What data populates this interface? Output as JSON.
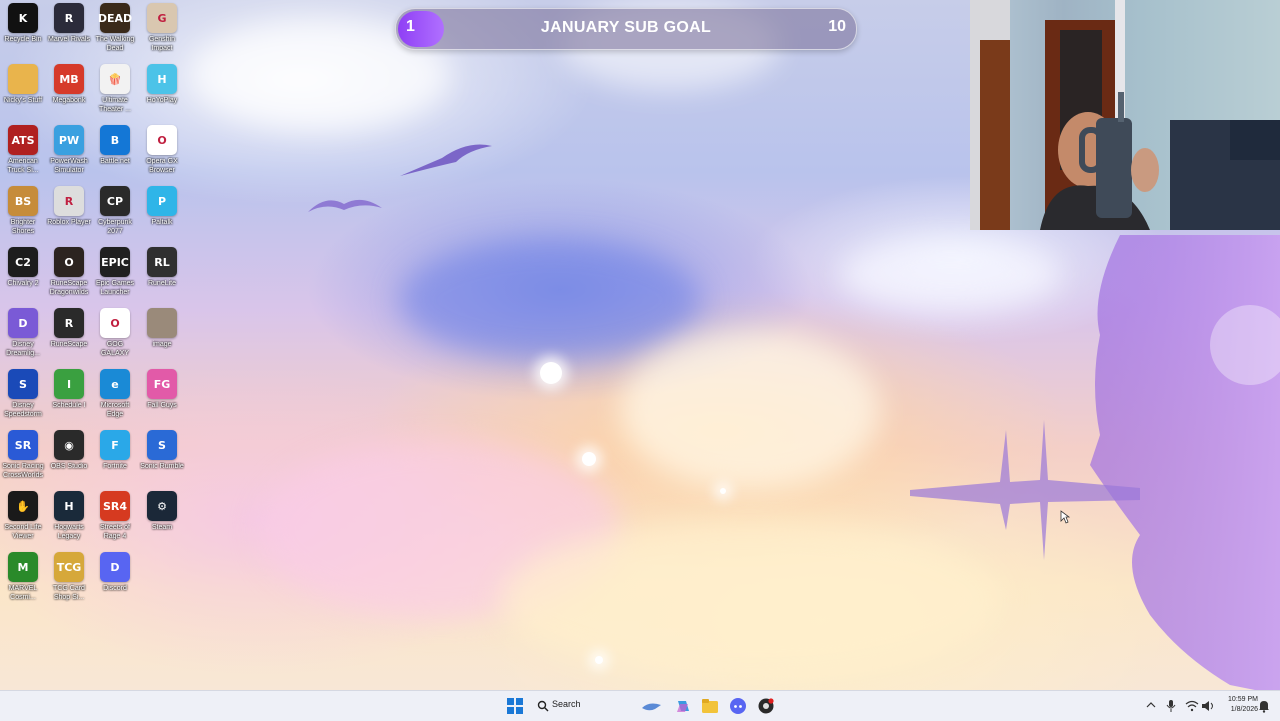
{
  "sub_goal": {
    "title": "JANUARY SUB GOAL",
    "current": "1",
    "target": "10",
    "progress": 0.1,
    "accent": "#8f3ff5"
  },
  "desktop_icons": [
    {
      "label": "Recycle Bin",
      "icon": "recycle-bin-icon",
      "color": "#111111",
      "glyph": "K"
    },
    {
      "label": "Marvel Rivals",
      "icon": "marvel-rivals-icon",
      "color": "#2b2b3a",
      "glyph": "R"
    },
    {
      "label": "The Walking Dead",
      "icon": "walking-dead-icon",
      "color": "#3a2a1a",
      "glyph": "DEAD"
    },
    {
      "label": "Genshin Impact",
      "icon": "genshin-impact-icon",
      "color": "#d9c7b0",
      "glyph": "G"
    },
    {
      "label": "Nicky's Stuff",
      "icon": "folder-icon",
      "color": "#e9b44c",
      "glyph": ""
    },
    {
      "label": "Megabonk",
      "icon": "megabonk-icon",
      "color": "#d63a2a",
      "glyph": "MB"
    },
    {
      "label": "Ultimate Theater ...",
      "icon": "theater-icon",
      "color": "#f2f2f2",
      "glyph": "🍿"
    },
    {
      "label": "HoYoPlay",
      "icon": "hoyoplay-icon",
      "color": "#4cc3e8",
      "glyph": "H"
    },
    {
      "label": "American Truck Si...",
      "icon": "american-truck-icon",
      "color": "#b02020",
      "glyph": "ATS"
    },
    {
      "label": "PowerWash Simulator",
      "icon": "powerwash-icon",
      "color": "#3aa0e0",
      "glyph": "PW"
    },
    {
      "label": "Battle.net",
      "icon": "battlenet-icon",
      "color": "#1477d6",
      "glyph": "B"
    },
    {
      "label": "Opera GX Browser",
      "icon": "opera-gx-icon",
      "color": "#ffffff",
      "glyph": "O"
    },
    {
      "label": "Brighter Shores",
      "icon": "brighter-shores-icon",
      "color": "#c68c3a",
      "glyph": "BS"
    },
    {
      "label": "Roblox Player",
      "icon": "roblox-icon",
      "color": "#dddddd",
      "glyph": "R"
    },
    {
      "label": "Cyberpunk 2077",
      "icon": "cyberpunk-icon",
      "color": "#2a2a2a",
      "glyph": "CP"
    },
    {
      "label": "Paltalk",
      "icon": "paltalk-icon",
      "color": "#2fb5e8",
      "glyph": "P"
    },
    {
      "label": "Chivalry 2",
      "icon": "chivalry-icon",
      "color": "#1d1d1d",
      "glyph": "C2"
    },
    {
      "label": "RuneScape Dragonwilds",
      "icon": "dragonwilds-icon",
      "color": "#2c2420",
      "glyph": "O"
    },
    {
      "label": "Epic Games Launcher",
      "icon": "epic-games-icon",
      "color": "#202020",
      "glyph": "EPIC"
    },
    {
      "label": "RuneLite",
      "icon": "runelite-icon",
      "color": "#303030",
      "glyph": "RL"
    },
    {
      "label": "Disney Dreamlig...",
      "icon": "disney-dreamlight-icon",
      "color": "#7a5ad6",
      "glyph": "D"
    },
    {
      "label": "RuneScape",
      "icon": "runescape-icon",
      "color": "#2a2a2a",
      "glyph": "R"
    },
    {
      "label": "GOG GALAXY",
      "icon": "gog-galaxy-icon",
      "color": "#ffffff",
      "glyph": "O"
    },
    {
      "label": "image",
      "icon": "image-icon",
      "color": "#9a8a7a",
      "glyph": ""
    },
    {
      "label": "Disney Speedstorm",
      "icon": "speedstorm-icon",
      "color": "#1a4ab8",
      "glyph": "S"
    },
    {
      "label": "Schedule I",
      "icon": "schedule-one-icon",
      "color": "#3aa040",
      "glyph": "I"
    },
    {
      "label": "Microsoft Edge",
      "icon": "edge-icon",
      "color": "#1a8ad6",
      "glyph": "e"
    },
    {
      "label": "Fall Guys",
      "icon": "fall-guys-icon",
      "color": "#e25aa8",
      "glyph": "FG"
    },
    {
      "label": "Sonic Racing CrossWorlds",
      "icon": "sonic-racing-icon",
      "color": "#2a5ad6",
      "glyph": "SR"
    },
    {
      "label": "OBS Studio",
      "icon": "obs-studio-icon",
      "color": "#2a2a2a",
      "glyph": "◉"
    },
    {
      "label": "Fortnite",
      "icon": "fortnite-icon",
      "color": "#2aa8e8",
      "glyph": "F"
    },
    {
      "label": "Sonic Rumble",
      "icon": "sonic-rumble-icon",
      "color": "#2a6ad6",
      "glyph": "S"
    },
    {
      "label": "Second Life Viewer",
      "icon": "second-life-icon",
      "color": "#1a1a1a",
      "glyph": "✋"
    },
    {
      "label": "Hogwarts Legacy",
      "icon": "hogwarts-icon",
      "color": "#1a2a3a",
      "glyph": "H"
    },
    {
      "label": "Streets of Rage 4",
      "icon": "streets-of-rage-icon",
      "color": "#d63a20",
      "glyph": "SR4"
    },
    {
      "label": "Steam",
      "icon": "steam-icon",
      "color": "#1b2838",
      "glyph": "⚙"
    },
    {
      "label": "MARVEL Cosmi...",
      "icon": "marvel-cosmic-icon",
      "color": "#2a8a2a",
      "glyph": "M"
    },
    {
      "label": "TCG Card Shop Si...",
      "icon": "tcg-card-shop-icon",
      "color": "#d6a83a",
      "glyph": "TCG"
    },
    {
      "label": "Discord",
      "icon": "discord-icon",
      "color": "#5865f2",
      "glyph": "D"
    }
  ],
  "taskbar": {
    "search_label": "Search",
    "apps": [
      {
        "icon": "windows-start-icon"
      },
      {
        "icon": "search-icon"
      },
      {
        "icon": "widget-icon"
      },
      {
        "icon": "copilot-icon"
      },
      {
        "icon": "file-explorer-icon"
      },
      {
        "icon": "discord-icon"
      },
      {
        "icon": "obs-studio-icon"
      }
    ],
    "time": "10:59 PM",
    "date": "1/8/2026"
  }
}
